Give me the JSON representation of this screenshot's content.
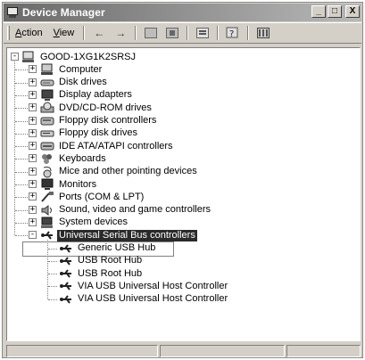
{
  "window": {
    "title": "Device Manager"
  },
  "title_buttons": {
    "minimize": "_",
    "maximize": "□",
    "close": "X"
  },
  "menu": {
    "action": {
      "ul": "A",
      "rest": "ction"
    },
    "view": {
      "ul": "V",
      "rest": "iew"
    }
  },
  "toolbar": {
    "back": "←",
    "forward": "→"
  },
  "tree": {
    "root": "GOOD-1XG1K2SRSJ",
    "categories": [
      {
        "label": "Computer",
        "icon": "computer-icon"
      },
      {
        "label": "Disk drives",
        "icon": "disk-drive-icon"
      },
      {
        "label": "Display adapters",
        "icon": "display-adapter-icon"
      },
      {
        "label": "DVD/CD-ROM drives",
        "icon": "cdrom-icon"
      },
      {
        "label": "Floppy disk controllers",
        "icon": "floppy-controller-icon"
      },
      {
        "label": "Floppy disk drives",
        "icon": "floppy-drive-icon"
      },
      {
        "label": "IDE ATA/ATAPI controllers",
        "icon": "ide-controller-icon"
      },
      {
        "label": "Keyboards",
        "icon": "keyboard-icon"
      },
      {
        "label": "Mice and other pointing devices",
        "icon": "mouse-icon"
      },
      {
        "label": "Monitors",
        "icon": "monitor-icon"
      },
      {
        "label": "Ports (COM & LPT)",
        "icon": "port-icon"
      },
      {
        "label": "Sound, video and game controllers",
        "icon": "sound-icon"
      },
      {
        "label": "System devices",
        "icon": "system-device-icon"
      },
      {
        "label": "Universal Serial Bus controllers",
        "icon": "usb-icon",
        "expanded": true,
        "selected": true
      }
    ],
    "usb_children": [
      {
        "label": "Generic USB Hub",
        "focused": true
      },
      {
        "label": "USB Root Hub"
      },
      {
        "label": "USB Root Hub"
      },
      {
        "label": "VIA USB Universal Host Controller"
      },
      {
        "label": "VIA USB Universal Host Controller"
      }
    ]
  }
}
